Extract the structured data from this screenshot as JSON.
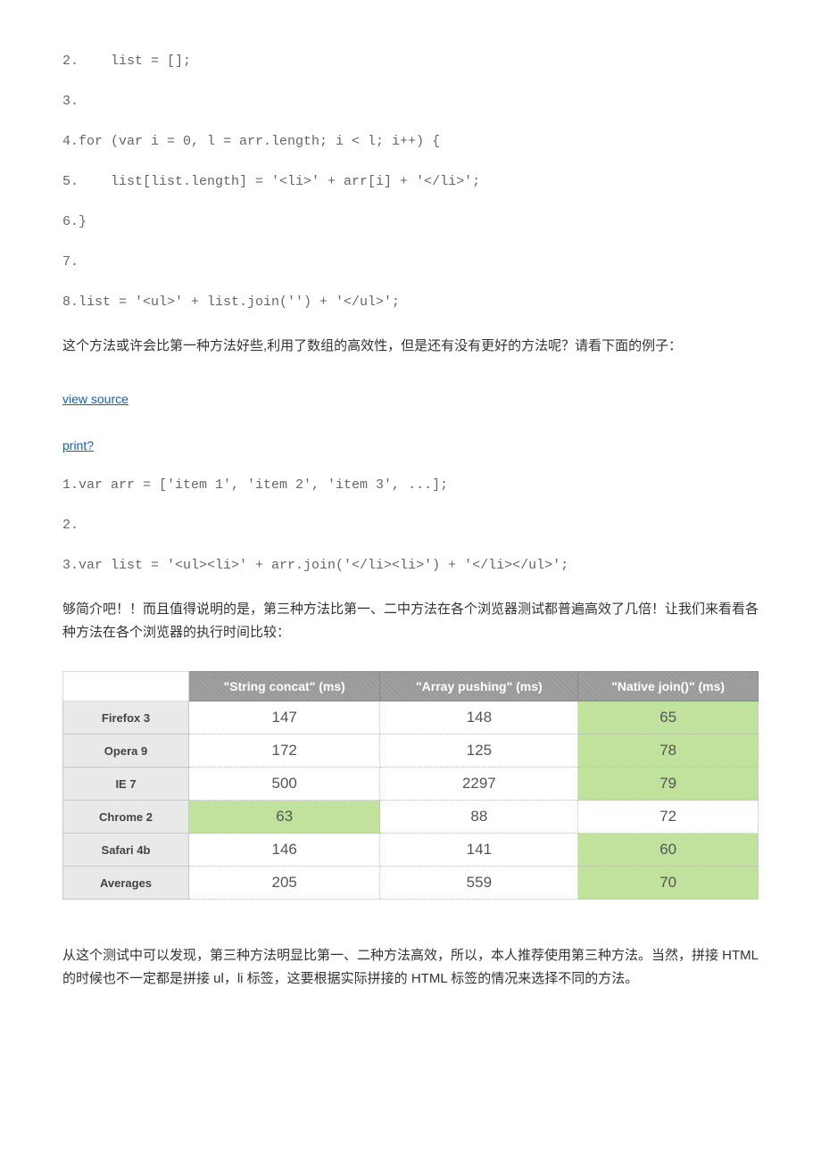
{
  "codeblock1": {
    "lines": [
      "2.    list = [];",
      "3.",
      "4.for (var i = 0, l = arr.length; i < l; i++) {",
      "5.    list[list.length] = '<li>' + arr[i] + '</li>';",
      "6.}",
      "7.",
      "8.list = '<ul>' + list.join('') + '</ul>';"
    ]
  },
  "para1": "这个方法或许会比第一种方法好些,利用了数组的高效性，但是还有没有更好的方法呢？请看下面的例子：",
  "links": {
    "view_source": "view source",
    "print": "print?"
  },
  "codeblock2": {
    "lines": [
      "1.var arr = ['item 1', 'item 2', 'item 3', ...];",
      "2.",
      "3.var list = '<ul><li>' + arr.join('</li><li>') + '</li></ul>';"
    ]
  },
  "para2": "够简介吧！！而且值得说明的是，第三种方法比第一、二中方法在各个浏览器测试都普遍高效了几倍！让我们来看看各种方法在各个浏览器的执行时间比较：",
  "chart_data": {
    "type": "table",
    "columns": [
      "\"String concat\" (ms)",
      "\"Array pushing\" (ms)",
      "\"Native join()\" (ms)"
    ],
    "rows": [
      {
        "label": "Firefox 3",
        "values": [
          147,
          148,
          65
        ],
        "highlight": [
          false,
          false,
          true
        ]
      },
      {
        "label": "Opera 9",
        "values": [
          172,
          125,
          78
        ],
        "highlight": [
          false,
          false,
          true
        ]
      },
      {
        "label": "IE 7",
        "values": [
          500,
          2297,
          79
        ],
        "highlight": [
          false,
          false,
          true
        ]
      },
      {
        "label": "Chrome 2",
        "values": [
          63,
          88,
          72
        ],
        "highlight": [
          true,
          false,
          false
        ]
      },
      {
        "label": "Safari 4b",
        "values": [
          146,
          141,
          60
        ],
        "highlight": [
          false,
          false,
          true
        ]
      },
      {
        "label": "Averages",
        "values": [
          205,
          559,
          70
        ],
        "highlight": [
          false,
          false,
          true
        ]
      }
    ]
  },
  "para3": "从这个测试中可以发现，第三种方法明显比第一、二种方法高效，所以，本人推荐使用第三种方法。当然，拼接 HTML 的时候也不一定都是拼接 ul，li 标签，这要根据实际拼接的 HTML 标签的情况来选择不同的方法。"
}
